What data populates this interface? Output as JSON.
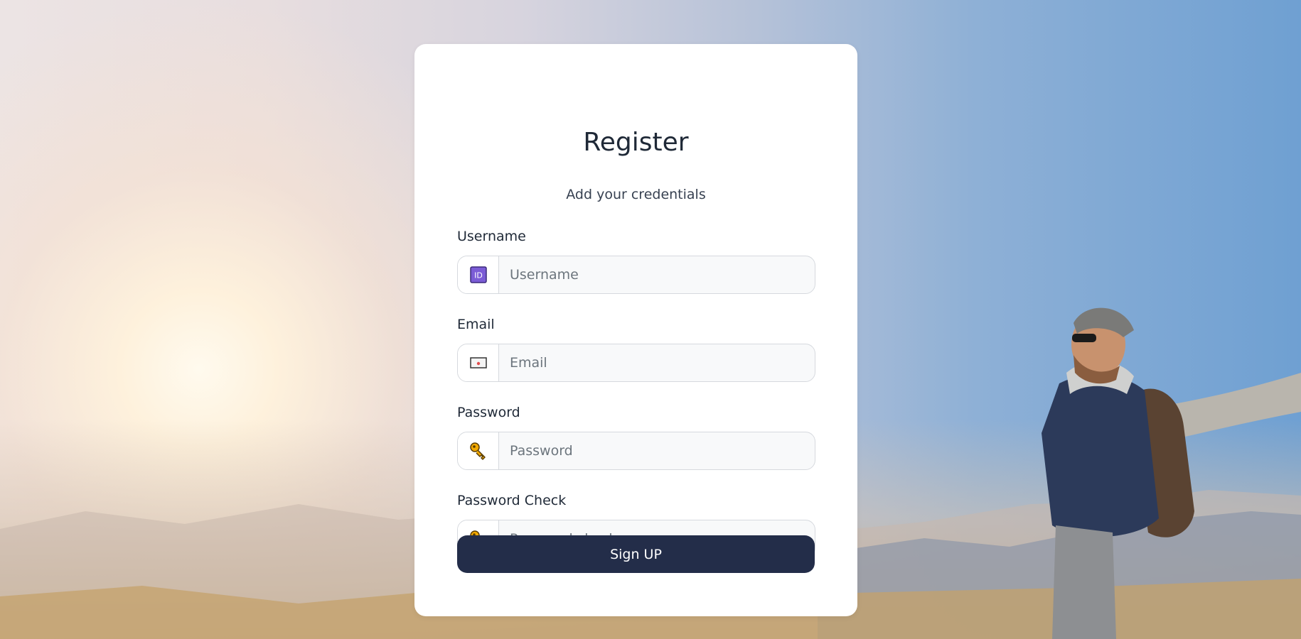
{
  "form": {
    "title": "Register",
    "subtitle": "Add your credentials",
    "fields": [
      {
        "label": "Username",
        "placeholder": "Username",
        "value": "",
        "icon": "id-badge-icon"
      },
      {
        "label": "Email",
        "placeholder": "Email",
        "value": "",
        "icon": "envelope-icon"
      },
      {
        "label": "Password",
        "placeholder": "Password",
        "value": "",
        "icon": "key-icon"
      },
      {
        "label": "Password Check",
        "placeholder": "Password check",
        "value": "",
        "icon": "key-icon"
      }
    ],
    "submit_label": "Sign UP"
  },
  "colors": {
    "button": "#232d49",
    "card": "#ffffff",
    "id_icon": "#7b5cd6",
    "key_icon": "#f2a900"
  }
}
